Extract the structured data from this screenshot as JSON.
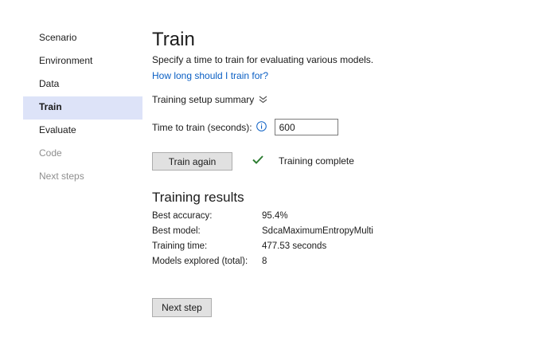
{
  "sidebar": {
    "items": [
      {
        "label": "Scenario",
        "state": "normal"
      },
      {
        "label": "Environment",
        "state": "normal"
      },
      {
        "label": "Data",
        "state": "normal"
      },
      {
        "label": "Train",
        "state": "active"
      },
      {
        "label": "Evaluate",
        "state": "normal"
      },
      {
        "label": "Code",
        "state": "disabled"
      },
      {
        "label": "Next steps",
        "state": "disabled"
      }
    ]
  },
  "main": {
    "title": "Train",
    "subtitle": "Specify a time to train for evaluating various models.",
    "help_link": "How long should I train for?",
    "summary_toggle": "Training setup summary",
    "time_label": "Time to train (seconds):",
    "time_value": "600",
    "train_button": "Train again",
    "status_text": "Training complete",
    "results_title": "Training results",
    "results": [
      {
        "label": "Best accuracy:",
        "value": "95.4%"
      },
      {
        "label": "Best model:",
        "value": "SdcaMaximumEntropyMulti"
      },
      {
        "label": "Training time:",
        "value": "477.53 seconds"
      },
      {
        "label": "Models explored (total):",
        "value": "8"
      }
    ],
    "next_button": "Next step"
  },
  "icons": {
    "summary_chevron": "double-chevron-down-icon",
    "info": "info-icon",
    "status": "checkmark-icon"
  },
  "colors": {
    "accent": "#0a5fc4",
    "active_nav_bg": "#dde3f8",
    "success": "#2d7d32",
    "disabled_text": "#8f8f8f"
  }
}
